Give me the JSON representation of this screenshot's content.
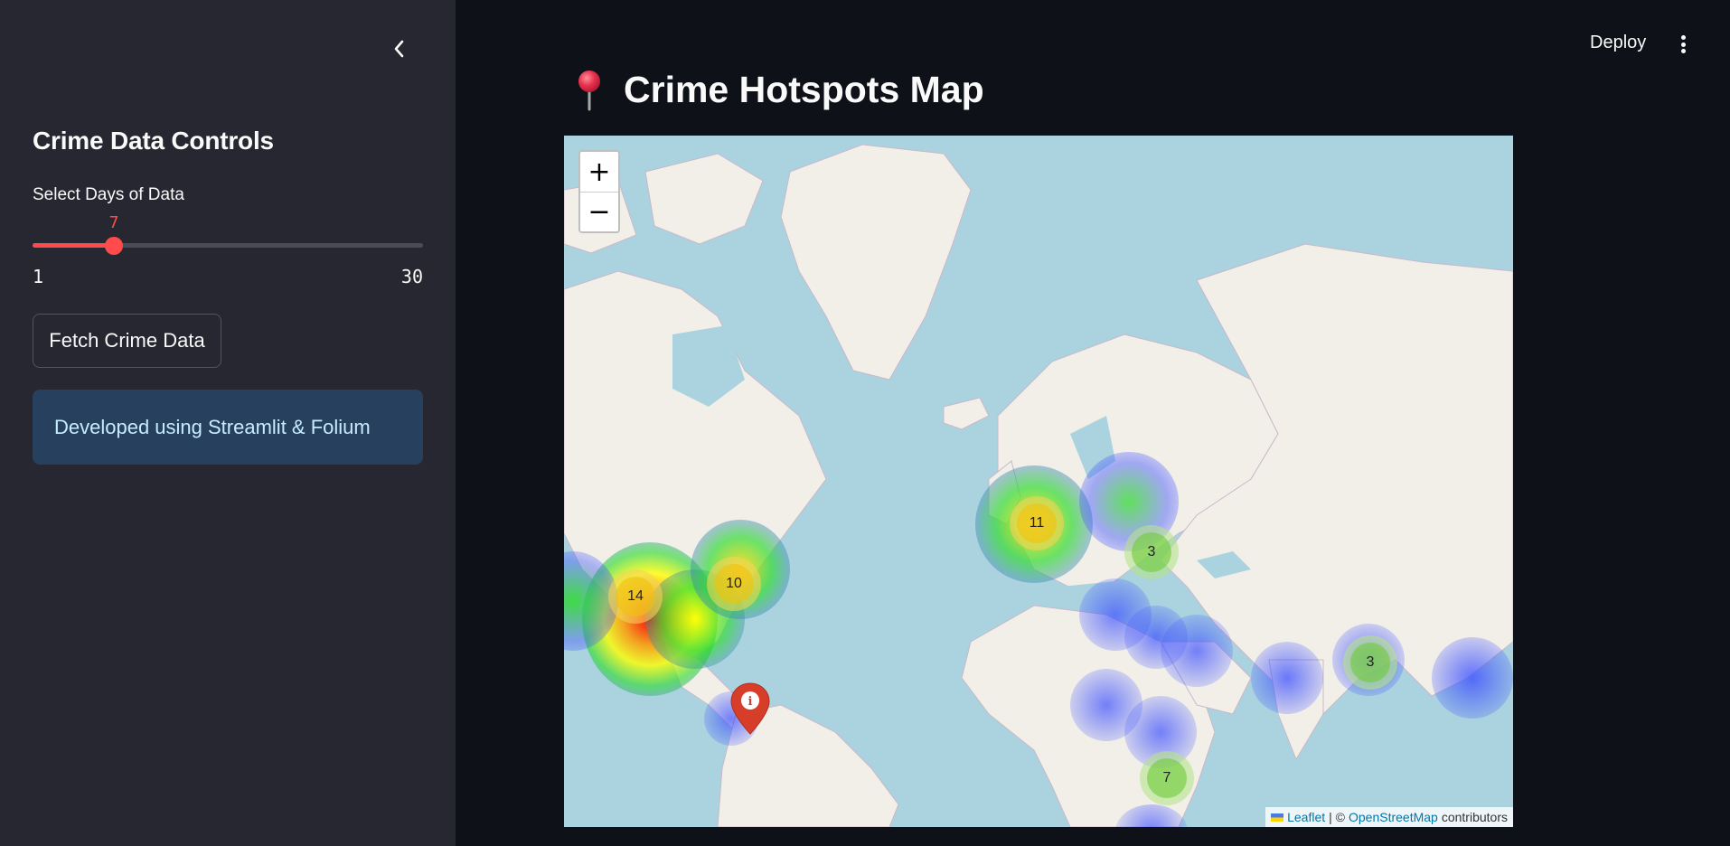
{
  "sidebar": {
    "title": "Crime Data Controls",
    "slider": {
      "label": "Select Days of Data",
      "value": "7",
      "min": "1",
      "max": "30",
      "fraction": 0.207
    },
    "fetch_button": "Fetch Crime Data",
    "info": "Developed using Streamlit & Folium"
  },
  "header": {
    "deploy": "Deploy"
  },
  "main": {
    "title": "Crime Hotspots Map"
  },
  "map": {
    "zoom_in": "+",
    "zoom_out": "−",
    "clusters": [
      {
        "count": "14",
        "color": "orange"
      },
      {
        "count": "10",
        "color": "orange"
      },
      {
        "count": "11",
        "color": "orange"
      },
      {
        "count": "3",
        "color": "green"
      },
      {
        "count": "3",
        "color": "green"
      },
      {
        "count": "7",
        "color": "green"
      }
    ],
    "attribution": {
      "leaflet": "Leaflet",
      "separator": "| ©",
      "osm": "OpenStreetMap",
      "contributors": "contributors"
    }
  },
  "colors": {
    "accent": "#ff4b4b",
    "sidebar_bg": "#262730",
    "main_bg": "#0e1117",
    "info_bg": "#27405e",
    "water": "#aad3df",
    "land": "#f2efe9"
  }
}
